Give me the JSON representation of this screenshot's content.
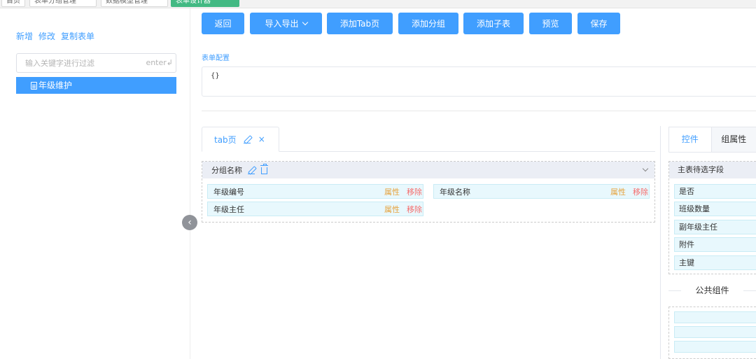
{
  "top_tabs": [
    "首页",
    "表单分组管理",
    "数据模型管理",
    "表单设计器"
  ],
  "sidebar": {
    "actions": [
      "新增",
      "修改",
      "复制表单"
    ],
    "search_placeholder": "输入关键字进行过滤",
    "search_hint": "enter↲",
    "tree_items": [
      "年级维护"
    ]
  },
  "toolbar": {
    "back": "返回",
    "import_export": "导入导出",
    "add_tab": "添加Tab页",
    "add_group": "添加分组",
    "add_subtable": "添加子表",
    "preview": "预览",
    "save": "保存"
  },
  "config": {
    "label": "表单配置",
    "value": "{}"
  },
  "tab": {
    "label": "tab页",
    "close": "×"
  },
  "group": {
    "name": "分组名称",
    "fields": [
      {
        "name": "年级编号",
        "attr": "属性",
        "remove": "移除"
      },
      {
        "name": "年级名称",
        "attr": "属性",
        "remove": "移除"
      },
      {
        "name": "年级主任",
        "attr": "属性",
        "remove": "移除"
      }
    ]
  },
  "right_panel": {
    "tabs": [
      "控件",
      "组属性"
    ],
    "fields_title": "主表待选字段",
    "fields": [
      "是否",
      "班级数量",
      "副年级主任",
      "附件",
      "主键"
    ],
    "public_title": "公共组件"
  },
  "colors": {
    "primary": "#409eff",
    "attr": "#e6a23c",
    "remove": "#f56c6c",
    "field_bg": "#e8f8fd"
  }
}
